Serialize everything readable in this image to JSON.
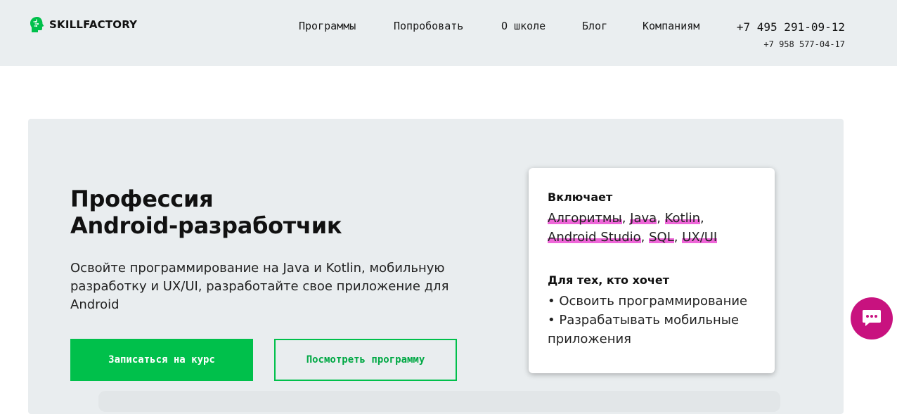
{
  "header": {
    "logo_text": "SKILLFACTORY",
    "nav": [
      {
        "label": "Программы"
      },
      {
        "label": "Попробовать"
      },
      {
        "label": "О школе"
      },
      {
        "label": "Блог"
      },
      {
        "label": "Компаниям"
      }
    ],
    "phone_main": "+7 495 291-09-12",
    "phone_sub": "+7 958 577-04-17"
  },
  "hero": {
    "title_line1": "Профессия",
    "title_line2": "Android-разработчик",
    "description": "Освойте программирование на Java и Kotlin, мобильную разработку и UX/UI, разработайте свое приложение для Android",
    "btn_enroll": "Записаться на курс",
    "btn_program": "Посмотреть программу"
  },
  "card": {
    "includes_heading": "Включает",
    "tags": [
      "Алгоритмы",
      "Java",
      "Kotlin",
      "Android Studio",
      "SQL",
      "UX/UI"
    ],
    "for_heading": "Для тех, кто хочет",
    "wants": [
      "• Освоить программирование",
      "• Разрабатывать мобильные приложения"
    ]
  },
  "colors": {
    "header_bg": "#eaeef0",
    "hero_bg": "#e9edef",
    "accent_green": "#00c04b",
    "highlight_pink": "#ee66d8",
    "chat_magenta": "#c8127f"
  },
  "icons": {
    "logo": "brain-head-logo-icon",
    "chat": "chat-bubble-icon"
  }
}
